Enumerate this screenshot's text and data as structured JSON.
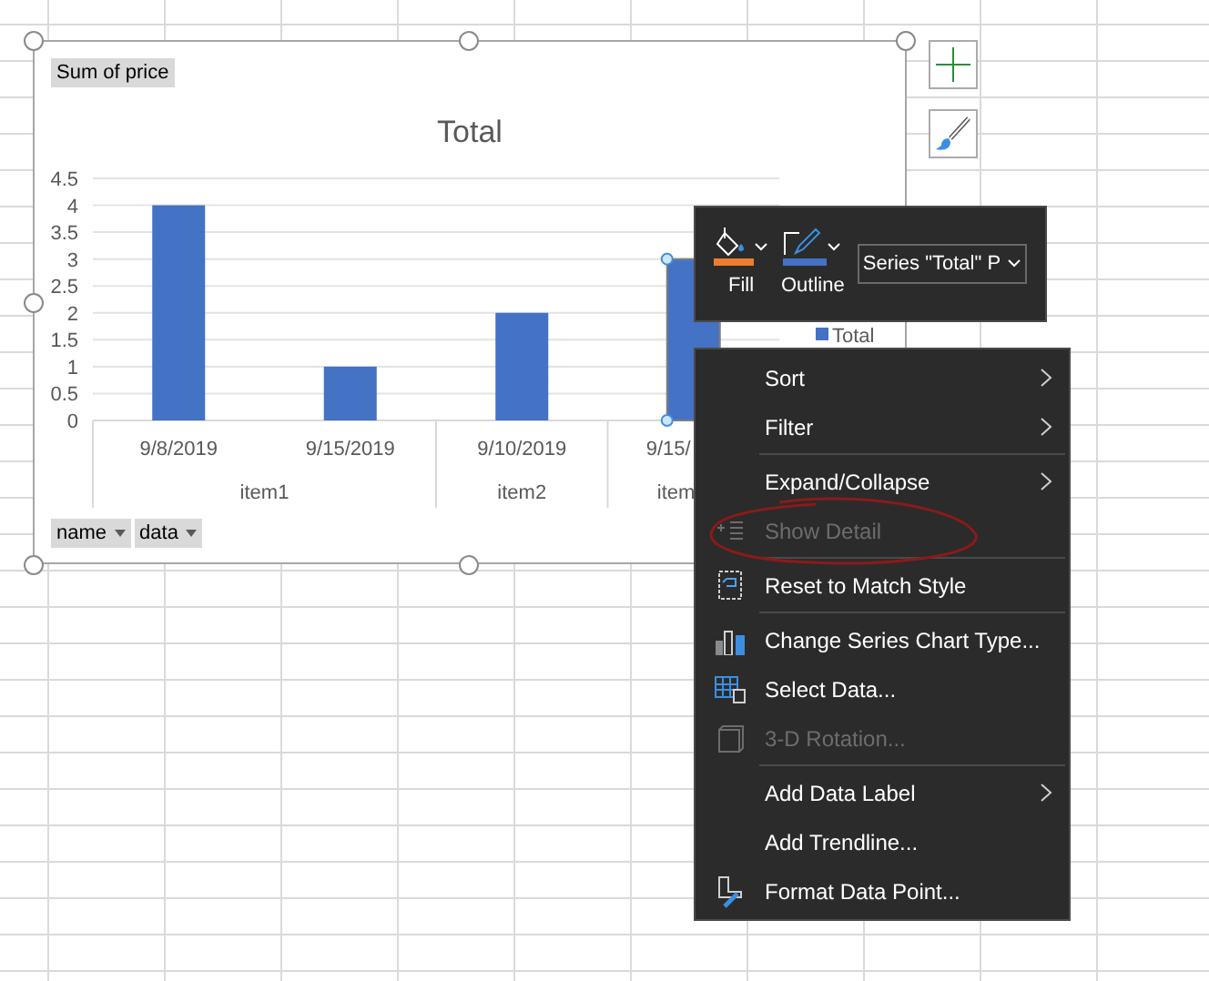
{
  "chart": {
    "field_button": "Sum of price",
    "chart_data": {
      "type": "bar",
      "title": "Total",
      "categories": [
        "9/8/2019",
        "9/15/2019",
        "9/10/2019",
        "9/15/"
      ],
      "series": [
        {
          "name": "Total",
          "color": "#4472c4",
          "values": [
            4,
            1,
            2,
            3
          ]
        }
      ],
      "ylim": [
        0,
        4.5
      ],
      "yticks": [
        0,
        0.5,
        1,
        1.5,
        2,
        2.5,
        3,
        3.5,
        4,
        4.5
      ],
      "grid": true
    },
    "groups": [
      {
        "label": "item1"
      },
      {
        "label": "item2"
      },
      {
        "label": "item"
      }
    ],
    "bar_states": [
      {
        "selected": false
      },
      {
        "selected": false
      },
      {
        "selected": false
      },
      {
        "selected": true
      }
    ],
    "axis_fields": [
      {
        "label": "name"
      },
      {
        "label": "data"
      }
    ]
  },
  "mini_toolbar": {
    "fill": {
      "label": "Fill",
      "color": "#ed7d31"
    },
    "outline": {
      "label": "Outline",
      "color": "#4472c4"
    },
    "selector": {
      "value": "Series \"Total\" P"
    }
  },
  "context_menu": [
    {
      "label": "Sort",
      "submenu": true,
      "disabled": false,
      "separator_before": false
    },
    {
      "label": "Filter",
      "submenu": true,
      "disabled": false,
      "separator_before": false
    },
    {
      "label": "Expand/Collapse",
      "submenu": true,
      "disabled": false,
      "separator_before": true
    },
    {
      "label": "Show Detail",
      "submenu": false,
      "disabled": true,
      "separator_before": false
    },
    {
      "label": "Reset to Match Style",
      "submenu": false,
      "disabled": false,
      "separator_before": true
    },
    {
      "label": "Change Series Chart Type...",
      "submenu": false,
      "disabled": false,
      "separator_before": true
    },
    {
      "label": "Select Data...",
      "submenu": false,
      "disabled": false,
      "separator_before": false
    },
    {
      "label": "3-D Rotation...",
      "submenu": false,
      "disabled": true,
      "separator_before": false
    },
    {
      "label": "Add Data Label",
      "submenu": true,
      "disabled": false,
      "separator_before": true
    },
    {
      "label": "Add Trendline...",
      "submenu": false,
      "disabled": false,
      "separator_before": false
    },
    {
      "label": "Format Data Point...",
      "submenu": false,
      "disabled": false,
      "separator_before": false
    }
  ]
}
